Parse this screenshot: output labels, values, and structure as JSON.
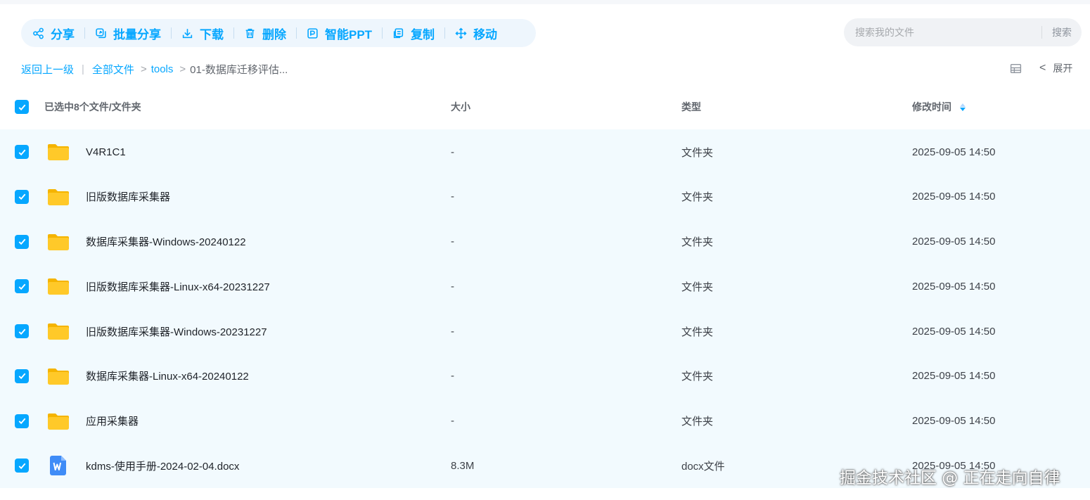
{
  "toolbar": {
    "share": "分享",
    "batch_share": "批量分享",
    "download": "下载",
    "delete": "删除",
    "smart_ppt": "智能PPT",
    "copy": "复制",
    "move": "移动"
  },
  "search": {
    "placeholder": "搜索我的文件",
    "button": "搜索"
  },
  "breadcrumb": {
    "back": "返回上一级",
    "separator": "|",
    "items": [
      "全部文件",
      "tools",
      "01-数据库迁移评估..."
    ]
  },
  "view": {
    "expand": "展开",
    "chevron": "<"
  },
  "table": {
    "headers": {
      "name": "已选中8个文件/文件夹",
      "size": "大小",
      "type": "类型",
      "modified": "修改时间"
    },
    "rows": [
      {
        "name": "V4R1C1",
        "size": "-",
        "type": "文件夹",
        "modified": "2025-09-05 14:50",
        "icon": "folder-icon"
      },
      {
        "name": "旧版数据库采集器",
        "size": "-",
        "type": "文件夹",
        "modified": "2025-09-05 14:50",
        "icon": "folder-icon"
      },
      {
        "name": "数据库采集器-Windows-20240122",
        "size": "-",
        "type": "文件夹",
        "modified": "2025-09-05 14:50",
        "icon": "folder-icon"
      },
      {
        "name": "旧版数据库采集器-Linux-x64-20231227",
        "size": "-",
        "type": "文件夹",
        "modified": "2025-09-05 14:50",
        "icon": "folder-icon"
      },
      {
        "name": "旧版数据库采集器-Windows-20231227",
        "size": "-",
        "type": "文件夹",
        "modified": "2025-09-05 14:50",
        "icon": "folder-icon"
      },
      {
        "name": "数据库采集器-Linux-x64-20240122",
        "size": "-",
        "type": "文件夹",
        "modified": "2025-09-05 14:50",
        "icon": "folder-icon"
      },
      {
        "name": "应用采集器",
        "size": "-",
        "type": "文件夹",
        "modified": "2025-09-05 14:50",
        "icon": "folder-icon"
      },
      {
        "name": "kdms-使用手册-2024-02-04.docx",
        "size": "8.3M",
        "type": "docx文件",
        "modified": "2025-09-05 14:50",
        "icon": "word-doc-icon"
      }
    ]
  },
  "watermark": "掘金技术社区 @ 正在走向自律",
  "colors": {
    "accent": "#06a7ff",
    "selected_row_bg": "#f2fafe",
    "toolbar_bg": "#eef6fd",
    "folder": "#ffc929",
    "word": "#3f8cf7"
  }
}
